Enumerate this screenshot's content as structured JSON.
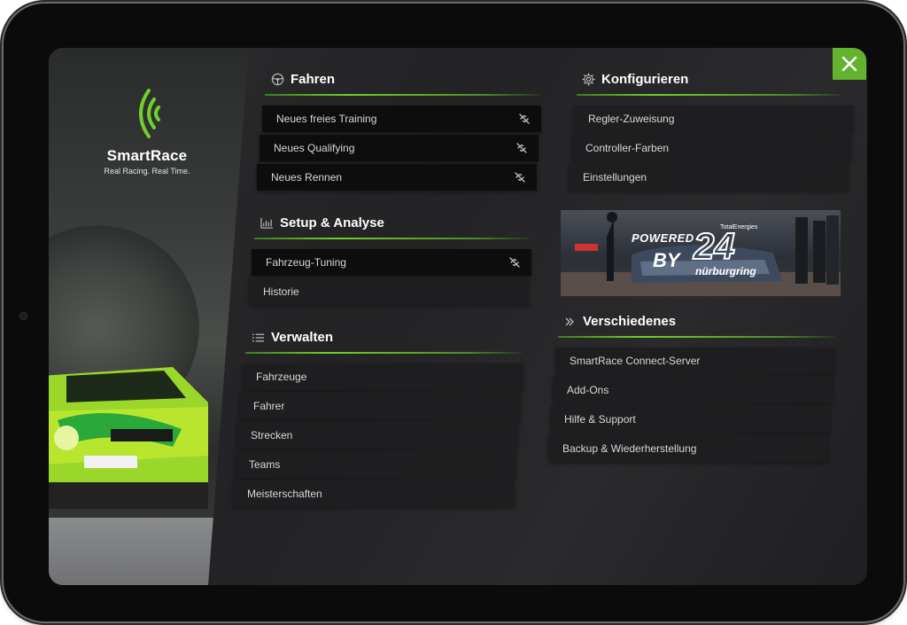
{
  "app": {
    "brand": "SmartRace",
    "tagline": "Real Racing. Real Time.",
    "accent_color": "#62b32d",
    "close_icon": "close-icon"
  },
  "sections": {
    "fahren": {
      "title": "Fahren",
      "icon": "steering-wheel-icon",
      "items": [
        {
          "label": "Neues freies Training",
          "icon": "link-broken-icon"
        },
        {
          "label": "Neues Qualifying",
          "icon": "link-broken-icon"
        },
        {
          "label": "Neues Rennen",
          "icon": "link-broken-icon"
        }
      ]
    },
    "setup": {
      "title": "Setup & Analyse",
      "icon": "bar-chart-icon",
      "items": [
        {
          "label": "Fahrzeug-Tuning",
          "icon": "link-broken-icon"
        },
        {
          "label": "Historie"
        }
      ]
    },
    "verwalten": {
      "title": "Verwalten",
      "icon": "list-icon",
      "items": [
        {
          "label": "Fahrzeuge"
        },
        {
          "label": "Fahrer"
        },
        {
          "label": "Strecken"
        },
        {
          "label": "Teams"
        },
        {
          "label": "Meisterschaften"
        }
      ]
    },
    "konfigurieren": {
      "title": "Konfigurieren",
      "icon": "gear-icon",
      "items": [
        {
          "label": "Regler-Zuweisung"
        },
        {
          "label": "Controller-Farben"
        },
        {
          "label": "Einstellungen"
        }
      ]
    },
    "verschiedenes": {
      "title": "Verschiedenes",
      "icon": "double-chevron-right-icon",
      "items": [
        {
          "label": "SmartRace Connect-Server"
        },
        {
          "label": "Add-Ons"
        },
        {
          "label": "Hilfe & Support"
        },
        {
          "label": "Backup & Wiederherstellung"
        }
      ]
    }
  },
  "banner": {
    "powered": "POWERED",
    "by": "BY",
    "number": "24",
    "sponsor": "TotalEnergies",
    "location": "nürburgring"
  }
}
